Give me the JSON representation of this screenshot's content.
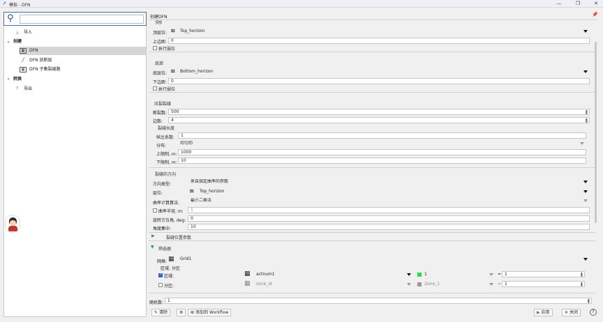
{
  "window": {
    "title": "模拟 - DFN"
  },
  "tree": [
    {
      "label": "导入",
      "indent": 1
    },
    {
      "label": "创建",
      "indent": 0,
      "bold": true
    },
    {
      "label": "DFN",
      "indent": 2
    },
    {
      "label": "DFN 放断层",
      "indent": 2
    },
    {
      "label": "DFN 子集裂缝路",
      "indent": 2
    },
    {
      "label": "转换",
      "indent": 0,
      "bold": true
    },
    {
      "label": "导出",
      "indent": 1
    }
  ],
  "panel": {
    "title": "创建DFN"
  },
  "top": {
    "section": "顶部",
    "surface_label": "顶层位:",
    "surface_value": "Top_horizon",
    "offset_label": "上边距:",
    "offset_value": "0",
    "check_label": "执行弱位"
  },
  "bottom": {
    "section": "底部",
    "surface_label": "底层位:",
    "surface_value": "Bottom_horizon",
    "offset_label": "下边距:",
    "offset_value": "0",
    "check_label": "执行弱位"
  },
  "fracture_density": {
    "section": "压裂裂缝",
    "count_label": "断裂数:",
    "count_value": "500",
    "edges_label": "边数:",
    "edges_value": "4",
    "length_section": "裂缝长度",
    "ratio_label": "纵比系数:",
    "ratio_value": "1",
    "dist_label": "分布:",
    "dist_value": "均匀的",
    "upper_label": "上限制, m:",
    "upper_value": "1000",
    "lower_label": "下限制, m:",
    "lower_value": "10"
  },
  "orientation": {
    "section": "裂缝的方向",
    "type_label": "方向类型:",
    "type_value": "来自指定曲率的参数",
    "horizon_label": "层位:",
    "horizon_value": "Top_horizon",
    "algo_label": "曲率计算算法:",
    "algo_value": "最小二乘法",
    "radius_label": "曲率半径, m:",
    "radius_value": "1",
    "azimuth_label": "旋转方位角, deg:",
    "azimuth_value": "0",
    "concentration_label": "角度集中:",
    "concentration_value": "10"
  },
  "position_params": {
    "label": "裂缝位置参数"
  },
  "filter": {
    "section": "筛选器",
    "grid_label": "网格:",
    "grid_value": "Grid1",
    "region_label": "区域, 分区",
    "zone_check_label": "区域:",
    "zone_prop": "actnum1",
    "zone_value": "1",
    "zone_eq": "=",
    "zone_num": "1",
    "part_check_label": "分区:",
    "part_prop": "zone_id",
    "part_value": "Zone_1",
    "part_eq": "=",
    "part_num": "1"
  },
  "seed": {
    "label": "随机数:",
    "value": "1"
  },
  "footer": {
    "clear_label": "清除",
    "workflow_label": "添加到 Workflow",
    "apply_label": "应用",
    "close_label": "关闭",
    "help_label": "?"
  },
  "colors": {
    "accent": "#2a66c8",
    "zone_swatch": "#2bd94a",
    "avatar_red": "#c0392b"
  }
}
